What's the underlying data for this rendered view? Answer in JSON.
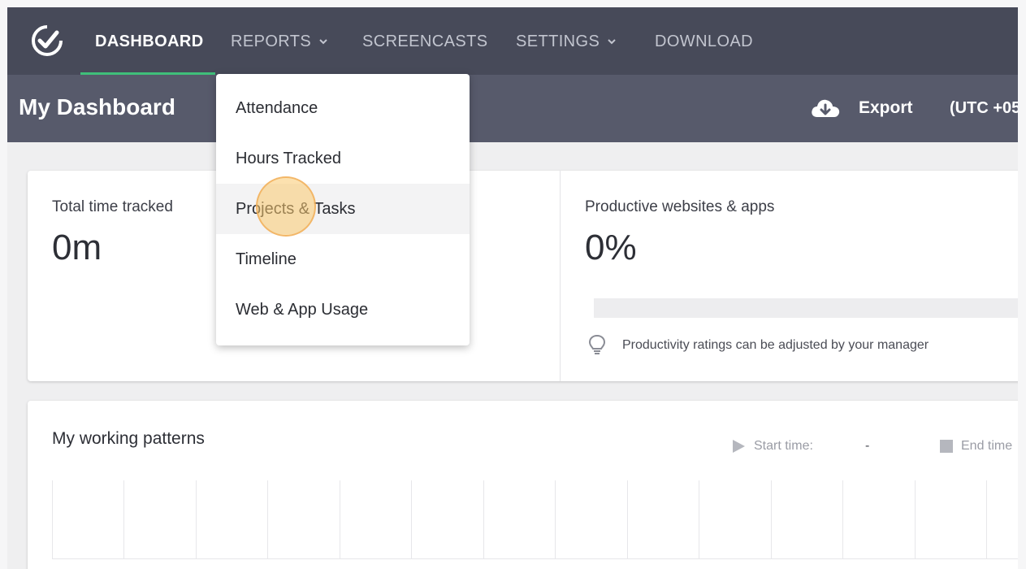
{
  "colors": {
    "nav_bg": "#474a59",
    "subheader_bg": "#575a6b",
    "accent_green": "#3fbf7a",
    "click_highlight": "#f9c872"
  },
  "nav": {
    "items": [
      {
        "label": "DASHBOARD",
        "active": true
      },
      {
        "label": "REPORTS",
        "has_dropdown": true
      },
      {
        "label": "SCREENCASTS"
      },
      {
        "label": "SETTINGS",
        "has_dropdown": true
      },
      {
        "label": "DOWNLOAD"
      }
    ],
    "logo_icon": "clock-check-icon"
  },
  "subheader": {
    "title": "My Dashboard",
    "export_label": "Export",
    "export_icon": "cloud-download-icon",
    "timezone": "(UTC +05"
  },
  "reports_menu": {
    "items": [
      "Attendance",
      "Hours Tracked",
      "Projects & Tasks",
      "Timeline",
      "Web & App Usage"
    ],
    "hovered": "Projects & Tasks"
  },
  "cards": {
    "total_time": {
      "label": "Total time tracked",
      "value": "0m"
    },
    "productive": {
      "label": "Productive websites & apps",
      "value": "0%",
      "tip": "Productivity ratings can be adjusted by your manager",
      "tip_icon": "lightbulb-icon"
    }
  },
  "working_patterns": {
    "title": "My working patterns",
    "start_label": "Start time:",
    "start_value": "-",
    "end_label": "End time"
  }
}
